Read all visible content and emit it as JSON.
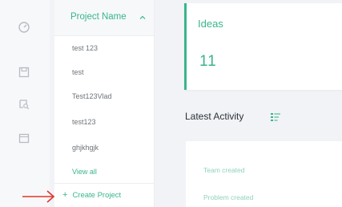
{
  "rail": {
    "icons": [
      "dashboard-icon",
      "save-icon",
      "search-user-icon",
      "calendar-icon"
    ]
  },
  "projects_panel": {
    "header_label": "Project Name",
    "sort_icon": "chevron-up-icon",
    "items": [
      "test 123",
      "test",
      "Test123Vlad",
      "test123",
      "ghjkhgjk"
    ],
    "view_all_label": "View all",
    "create_label": "Create Project",
    "create_icon": "plus-icon"
  },
  "ideas_card": {
    "label": "Ideas",
    "value": "11"
  },
  "activity": {
    "title": "Latest Activity",
    "icon": "filter-icon",
    "items": [
      "Team created",
      "Problem created"
    ]
  },
  "colors": {
    "accent": "#39b58c",
    "annotation": "#e0352b"
  }
}
